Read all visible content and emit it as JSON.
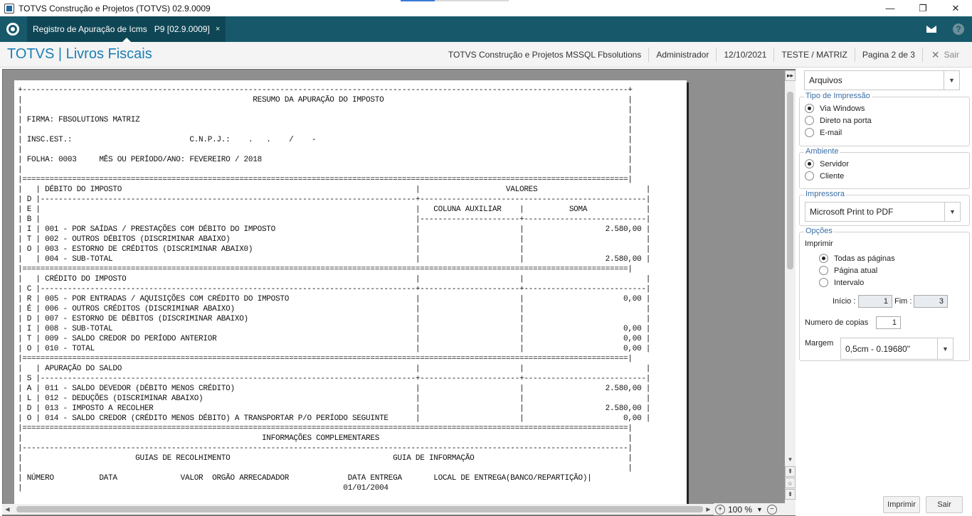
{
  "window": {
    "title": "TOTVS Construção e Projetos (TOTVS) 02.9.0009",
    "minimize": "—",
    "maximize": "❐",
    "close": "✕"
  },
  "appbar": {
    "tab_label": "Registro de Apuração de Icms   P9 [02.9.0009]",
    "tab_close": "×",
    "help": "?"
  },
  "header": {
    "brand": "TOTVS | Livros Fiscais",
    "company": "TOTVS Construção e Projetos MSSQL Fbsolutions",
    "user": "Administrador",
    "date": "12/10/2021",
    "branch": "TESTE / MATRIZ",
    "page": "Pagina 2 de 3",
    "exit_label": "Sair"
  },
  "report": {
    "lines": [
      "+--------------------------------------------------------------------------------------------------------------------------------------+",
      "|                                                   RESUMO DA APURAÇÃO DO IMPOSTO                                                      |",
      "|                                                                                                                                      |",
      "| FIRMA: FBSOLUTIONS MATRIZ                                                                                                            |",
      "|                                                                                                                                      |",
      "| INSC.EST.:                          C.N.P.J.:    .   .    /    -                                                                     |",
      "|                                                                                                                                      |",
      "| FOLHA: 0003     MÊS OU PERÍODO/ANO: FEVEREIRO / 2018                                                                                 |",
      "|                                                                                                                                      |",
      "|======================================================================================================================================|",
      "|   | DÉBITO DO IMPOSTO                                                                 |                   VALORES                        |",
      "| D |-----------------------------------------------------------------------------------+--------------------------------------------------|",
      "| E |                                                                                   |   COLUNA AUXILIAR    |          SOMA             |",
      "| B |                                                                                   |----------------------+---------------------------|",
      "| I | 001 - POR SAÍDAS / PRESTAÇÕES COM DÉBITO DO IMPOSTO                               |                      |                  2.580,00 |",
      "| T | 002 - OUTROS DÉBITOS (DISCRIMINAR ABAIXO)                                         |                      |                           |",
      "| O | 003 - ESTORNO DE CRÉDITOS (DISCRIMINAR ABAIX0)                                    |                      |                           |",
      "|   | 004 - SUB-TOTAL                                                                   |                      |                  2.580,00 |",
      "|======================================================================================================================================|",
      "|   | CRÉDITO DO IMPOSTO                                                                |                      |                           |",
      "| C |-----------------------------------------------------------------------------------+----------------------+---------------------------|",
      "| R | 005 - POR ENTRADAS / AQUISIÇÕES COM CRÉDITO DO IMPOSTO                            |                      |                      0,00 |",
      "| É | 006 - OUTROS CRÉDITOS (DISCRIMINAR ABAIXO)                                        |                      |                           |",
      "| D | 007 - ESTORNO DE DÉBITOS (DISCRIMINAR ABAIXO)                                     |                      |                           |",
      "| I | 008 - SUB-TOTAL                                                                   |                      |                      0,00 |",
      "| T | 009 - SALDO CREDOR DO PERÍODO ANTERIOR                                            |                      |                      0,00 |",
      "| O | 010 - TOTAL                                                                       |                      |                      0,00 |",
      "|======================================================================================================================================|",
      "|   | APURAÇÃO DO SALDO                                                                 |                      |                           |",
      "| S |-----------------------------------------------------------------------------------+----------------------+---------------------------|",
      "| A | 011 - SALDO DEVEDOR (DÉBITO MENOS CRÉDITO)                                        |                      |                  2.580,00 |",
      "| L | 012 - DEDUÇÕES (DISCRIMINAR ABAIXO)                                               |                      |                           |",
      "| D | 013 - IMPOSTO A RECOLHER                                                          |                      |                  2.580,00 |",
      "| O | 014 - SALDO CREDOR (CRÉDITO MENOS DÉBITO) A TRANSPORTAR P/O PERÍODO SEGUINTE      |                      |                      0,00 |",
      "|======================================================================================================================================|",
      "|                                                     INFORMAÇÕES COMPLEMENTARES                                                       |",
      "|--------------------------------------------------------------------------------------------------------------------------------------|",
      "|                         GUIAS DE RECOLHIMENTO                                    GUIA DE INFORMAÇÃO                                  |",
      "|                                                                                                                                      |",
      "| NÚMERO          DATA              VALOR  ORGÃO ARRECADADOR             DATA ENTREGA       LOCAL DE ENTREGA(BANCO/REPARTIÇÃO)|",
      "|                                                                       01/01/2004                                                     "
    ]
  },
  "zoom": {
    "value": "100 %"
  },
  "panel": {
    "output_select": "Arquivos",
    "print_type": {
      "legend": "Tipo de Impressão",
      "options": [
        "Via Windows",
        "Direto na porta",
        "E-mail"
      ]
    },
    "environment": {
      "legend": "Ambiente",
      "options": [
        "Servidor",
        "Cliente"
      ]
    },
    "printer": {
      "legend": "Impressora",
      "value": "Microsoft Print to PDF"
    },
    "options": {
      "legend": "Opções",
      "print_label": "Imprimir",
      "pages": [
        "Todas as páginas",
        "Página atual",
        "Intervalo"
      ],
      "start_label": "Início :",
      "start_value": "1",
      "end_label": "Fim :",
      "end_value": "3",
      "copies_label": "Numero de copias",
      "copies_value": "1",
      "margin_label": "Margem",
      "margin_value": "0,5cm - 0.19680\""
    },
    "print_button": "Imprimir",
    "exit_button": "Sair"
  }
}
